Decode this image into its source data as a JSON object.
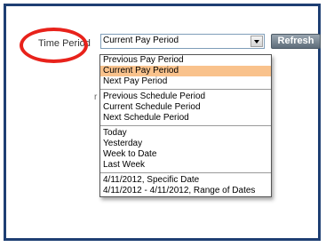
{
  "time_period": {
    "label": "Time Period",
    "selected_value": "Current Pay Period",
    "refresh_label": "Refresh"
  },
  "dropdown": {
    "groups": [
      [
        {
          "label": "Previous Pay Period",
          "selected": false
        },
        {
          "label": "Current Pay Period",
          "selected": true
        },
        {
          "label": "Next Pay Period",
          "selected": false
        }
      ],
      [
        {
          "label": "Previous Schedule Period",
          "selected": false
        },
        {
          "label": "Current Schedule Period",
          "selected": false
        },
        {
          "label": "Next Schedule Period",
          "selected": false
        }
      ],
      [
        {
          "label": "Today",
          "selected": false
        },
        {
          "label": "Yesterday",
          "selected": false
        },
        {
          "label": "Week to Date",
          "selected": false
        },
        {
          "label": "Last Week",
          "selected": false
        }
      ],
      [
        {
          "label": "4/11/2012, Specific Date",
          "selected": false
        },
        {
          "label": "4/11/2012 - 4/11/2012, Range of Dates",
          "selected": false
        }
      ]
    ]
  },
  "colors": {
    "panel_border": "#1e3f73",
    "highlight_ellipse": "#e8221b",
    "selected_option_bg": "#f9c28c",
    "refresh_button": "#6f7d89"
  }
}
